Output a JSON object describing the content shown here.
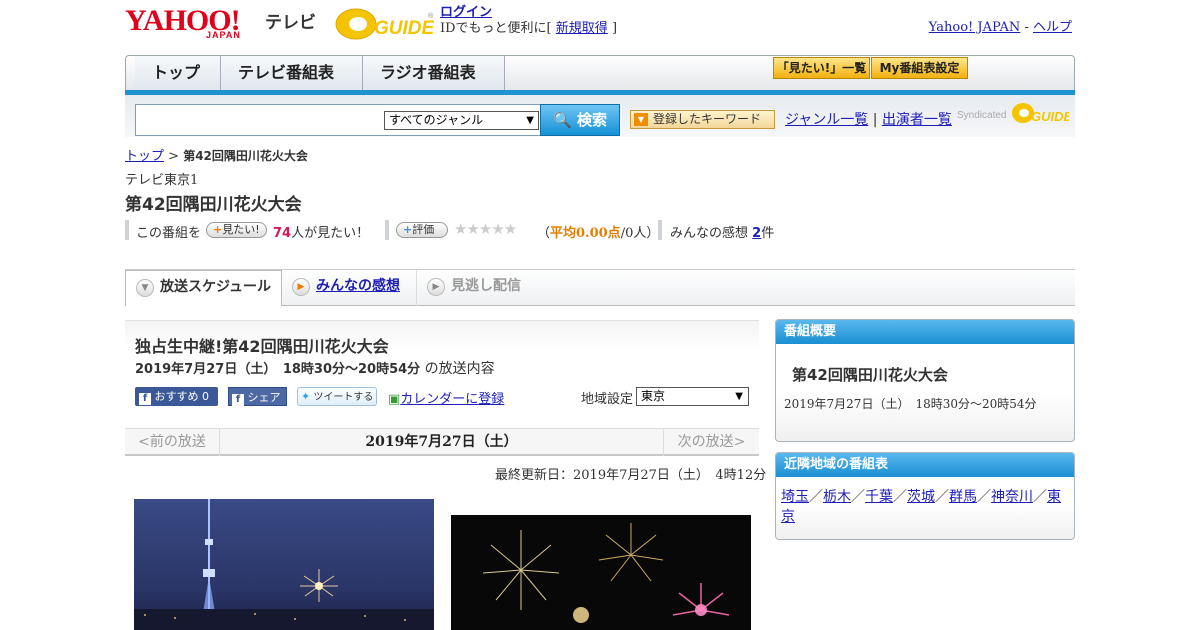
{
  "header": {
    "yahoo_logo": "YAHOO!",
    "japan": "JAPAN",
    "tv": "テレビ",
    "gguide": "G GUIDE",
    "login": "ログイン",
    "login_desc": "IDでもっと便利に[",
    "register": "新規取得",
    "login_close": "]",
    "yahoo_japan_link": "Yahoo! JAPAN",
    "sep": "-",
    "help": "ヘルプ"
  },
  "nav": {
    "tabs": [
      "トップ",
      "テレビ番組表",
      "ラジオ番組表"
    ],
    "mitai_list": "「見たい!」一覧",
    "my_bangumi": "My番組表設定"
  },
  "search": {
    "genre_selected": "すべてのジャンル",
    "search_button": "検索",
    "keyword_button": "登録したキーワード",
    "genre_list": "ジャンル一覧",
    "divider": "|",
    "performer_list": "出演者一覧",
    "syndicated": "Syndicated"
  },
  "breadcrumb": {
    "top": "トップ",
    "sep": ">",
    "current": "第42回隅田川花火大会"
  },
  "program": {
    "channel": "テレビ東京1",
    "title": "第42回隅田川花火大会",
    "want_prefix": "この番組を",
    "want_button": "見たい!",
    "want_count": "74",
    "want_suffix": "人が見たい！",
    "rate_button": "評価",
    "stars": "★★★★★",
    "avg_open": "（",
    "avg_label": "平均0.00点",
    "avg_people": "/0人）",
    "impressions_label": "みんなの感想",
    "impressions_count": "2",
    "impressions_unit": "件"
  },
  "tabs": {
    "schedule": "放送スケジュール",
    "impressions": "みんなの感想",
    "missed": "見逃し配信"
  },
  "broadcast": {
    "title": "独占生中継!第42回隅田川花火大会",
    "datetime": "2019年7月27日（土）　18時30分～20時54分",
    "suffix": "の放送内容",
    "fb_recommend": "おすすめ 0",
    "fb_share": "シェア",
    "tweet": "ツイートする",
    "calendar": "カレンダーに登録",
    "region_label": "地域設定",
    "region_value": "東京",
    "prev": "<前の放送",
    "current_date": "2019年7月27日（土）",
    "next": "次の放送>",
    "updated": "最終更新日：2019年7月27日（土）　4時12分"
  },
  "sidebar": {
    "overview_header": "番組概要",
    "overview_title": "第42回隅田川花火大会",
    "overview_time": "2019年7月27日（土）　18時30分～20時54分",
    "nearby_header": "近隣地域の番組表",
    "regions": [
      "埼玉",
      "栃木",
      "千葉",
      "茨城",
      "群馬",
      "神奈川",
      "東京"
    ],
    "region_sep": "／"
  }
}
